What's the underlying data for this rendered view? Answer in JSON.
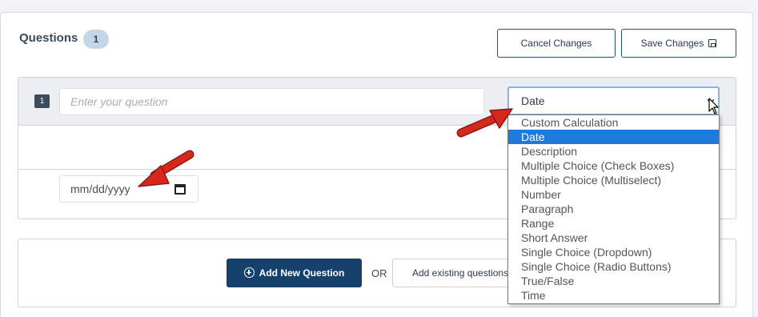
{
  "header": {
    "title": "Questions",
    "count": "1"
  },
  "toolbar": {
    "cancel_label": "Cancel Changes",
    "save_label": "Save Changes"
  },
  "question": {
    "number": "1",
    "placeholder": "Enter your question",
    "type_selected": "Date",
    "date_placeholder": "mm/dd/yyyy"
  },
  "dropdown": {
    "options": [
      "Custom Calculation",
      "Date",
      "Description",
      "Multiple Choice (Check Boxes)",
      "Multiple Choice (Multiselect)",
      "Number",
      "Paragraph",
      "Range",
      "Short Answer",
      "Single Choice (Dropdown)",
      "Single Choice (Radio Buttons)",
      "True/False",
      "Time"
    ],
    "selected_index": 1
  },
  "footer": {
    "add_label": "Add New Question",
    "or_label": "OR",
    "existing_label": "Add existing questions"
  },
  "colors": {
    "primary": "#16416d",
    "selected": "#1e7bd9",
    "annotation_arrow": "#d6281d"
  },
  "icons": {
    "save": "save-icon",
    "calendar": "calendar-icon",
    "add": "plus-circle-icon",
    "cursor": "mouse-pointer-icon"
  }
}
